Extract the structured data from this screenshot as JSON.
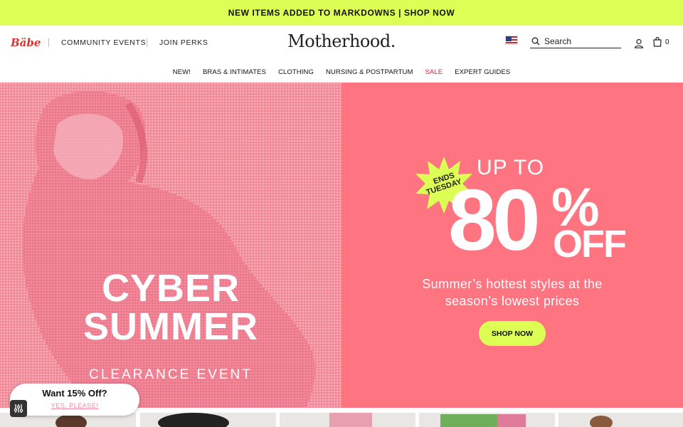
{
  "announcement": {
    "text": "NEW ITEMS ADDED TO MARKDOWNS | SHOP NOW"
  },
  "header": {
    "babe_logo": "Bäbe",
    "links": [
      "COMMUNITY EVENTS",
      "JOIN PERKS"
    ],
    "logo": "Motherhood.",
    "search_placeholder": "Search",
    "cart_count": "0"
  },
  "nav": {
    "items": [
      "NEW!",
      "BRAS & INTIMATES",
      "CLOTHING",
      "NURSING & POSTPARTUM",
      "SALE",
      "EXPERT GUIDES"
    ]
  },
  "hero": {
    "left": {
      "line1": "CYBER",
      "line2": "SUMMER",
      "subtitle": "CLEARANCE EVENT"
    },
    "right": {
      "badge_line1": "ENDS",
      "badge_line2": "TUESDAY",
      "up_to": "UP TO",
      "number": "80",
      "percent": "%",
      "off": "OFF",
      "subtitle_line1": "Summer’s hottest styles at the",
      "subtitle_line2": "season’s lowest prices",
      "cta": "SHOP NOW"
    }
  },
  "popup": {
    "title": "Want 15% Off?",
    "link": "YES, PLEASE!"
  },
  "colors": {
    "accent_lime": "#ddff55",
    "hero_pink": "#ff7481",
    "sale_red": "#d8262f"
  }
}
